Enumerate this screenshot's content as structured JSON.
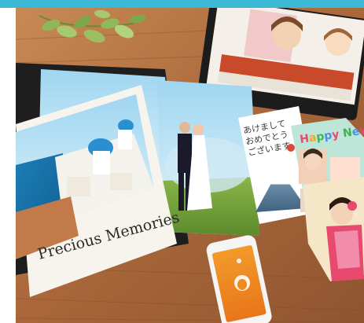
{
  "book": {
    "title": "Precious Memories"
  },
  "greeting_card": {
    "line1": "あけまして",
    "line2": "おめでとう",
    "line3": "ございます"
  },
  "new_year_card": {
    "headline": "Happy New",
    "headline_colors": [
      "#e84a6f",
      "#f5a623",
      "#3fb34f",
      "#4a90e2",
      "#e84a6f",
      "#f5a623",
      "#3fb34f",
      "#4a90e2",
      "#e84a6f"
    ]
  },
  "colors": {
    "top_band": "#3bb8d6",
    "phone_screen": "#f08a1c",
    "table": "#b37440"
  }
}
